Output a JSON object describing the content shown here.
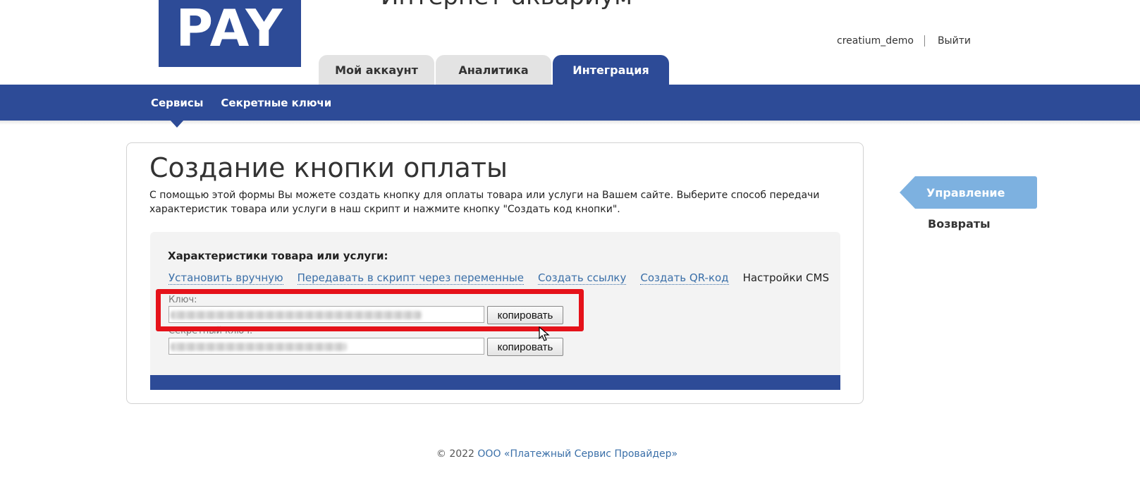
{
  "header": {
    "logo_text": "PAY",
    "shop_title": "Интернет-аквариум",
    "username": "creatium_demo",
    "logout": "Выйти"
  },
  "tabs": [
    {
      "label": "Мой аккаунт",
      "active": false
    },
    {
      "label": "Аналитика",
      "active": false
    },
    {
      "label": "Интеграция",
      "active": true
    }
  ],
  "subnav": [
    {
      "label": "Сервисы",
      "active": true
    },
    {
      "label": "Секретные ключи",
      "active": false
    }
  ],
  "main": {
    "title": "Создание кнопки оплаты",
    "description": "С помощью этой формы Вы можете создать кнопку для оплаты товара или услуги на Вашем сайте. Выберите способ передачи характеристик товара или услуги в наш скрипт и нажмите кнопку \"Создать код кнопки\".",
    "section_title": "Характеристики товара или услуги:",
    "method_links": [
      "Установить вручную",
      "Передавать в скрипт через переменные",
      "Создать ссылку",
      "Создать QR-код"
    ],
    "method_current": "Настройки CMS",
    "fields": [
      {
        "label": "Ключ:",
        "copy_label": "копировать"
      },
      {
        "label": "Секретный ключ:",
        "copy_label": "копировать"
      }
    ]
  },
  "sidebar": {
    "active_item": "Управление",
    "item": "Возвраты"
  },
  "footer": {
    "prefix": "© 2022 ",
    "company": "ООО «Платежный Сервис Провайдер»"
  },
  "colors": {
    "brand_blue": "#2d4b97",
    "sidebar_active": "#7db1e0",
    "link": "#3a6fa8",
    "highlight": "#e5121a"
  }
}
